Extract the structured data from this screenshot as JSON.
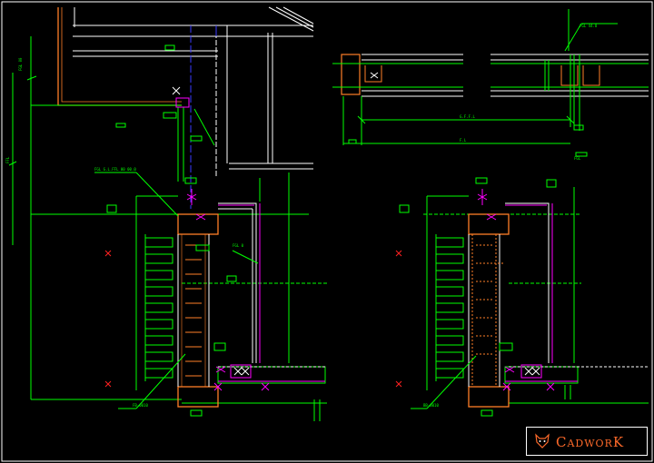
{
  "logo": {
    "text": "CadworK"
  },
  "colors": {
    "background": "#000000",
    "structure": "#00ff00",
    "column": "#ffffff",
    "steel": "#ff7f27",
    "accent": "#ff00ff",
    "axis": "#0000ff",
    "marker": "#ff0000"
  },
  "icons": {
    "logo_mark": "fox-head-icon"
  }
}
